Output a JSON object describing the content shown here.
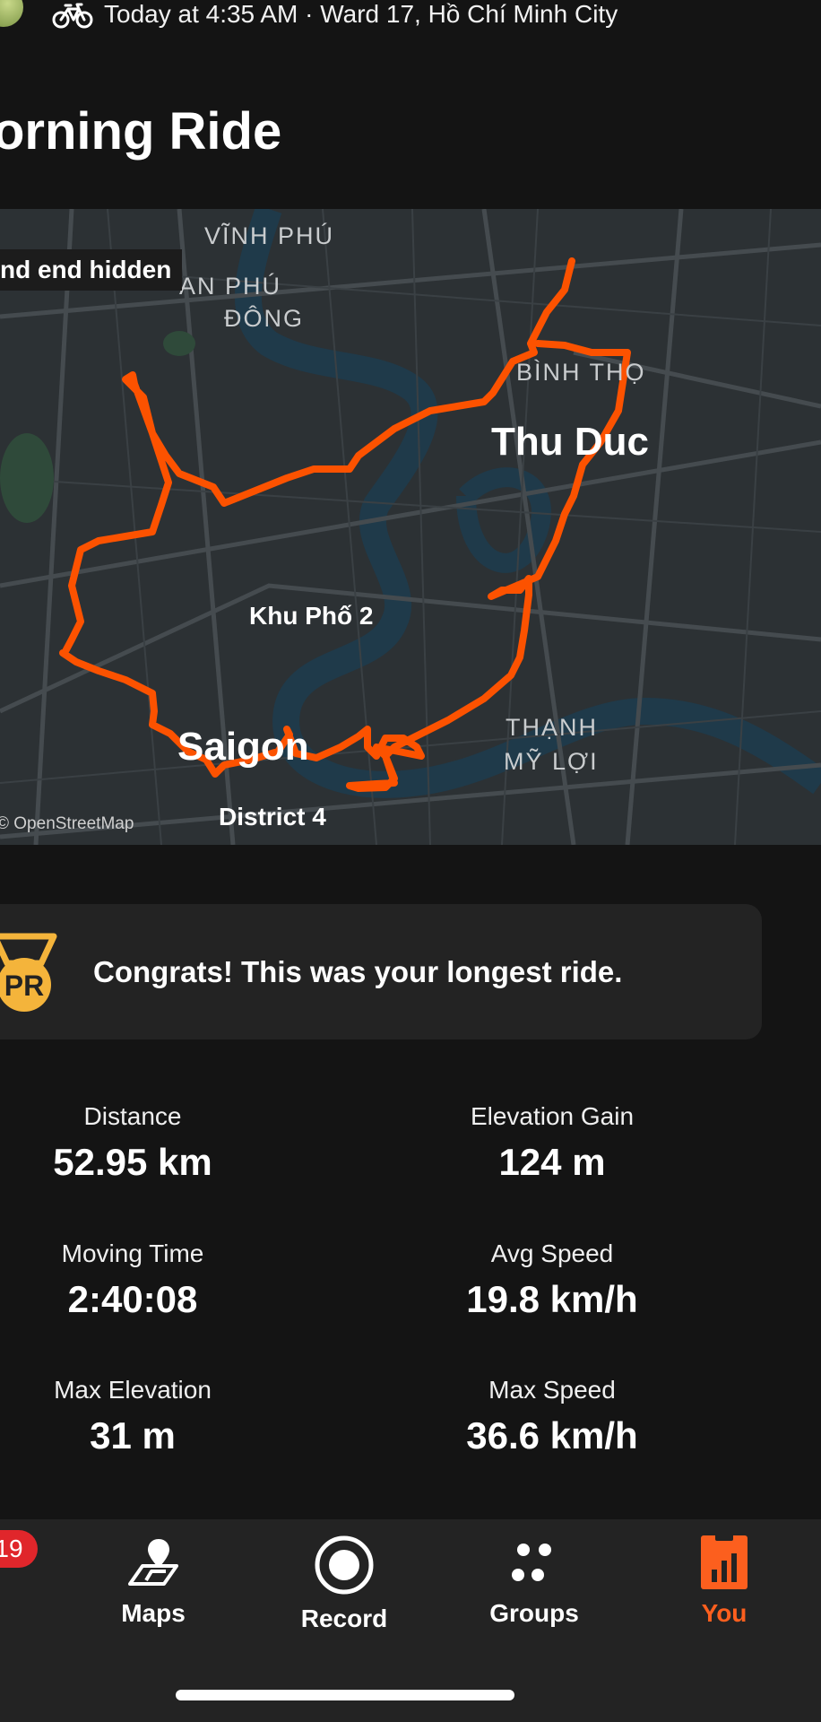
{
  "activity": {
    "meta": "Today at 4:35 AM · Ward 17, Hồ Chí Minh City",
    "title": "orning Ride"
  },
  "map": {
    "privacy_badge": "nd end hidden",
    "credit": "© OpenStreetMap",
    "labels": {
      "vinh_phu": "VĨNH PHÚ",
      "an_phu_dong": "AN PHÚ",
      "an_phu_dong_2": "ĐÔNG",
      "binh_tho": "BÌNH THỌ",
      "thu_duc": "Thu Duc",
      "khu_pho": "Khu Phố 2",
      "saigon": "Saigon",
      "district4": "District 4",
      "thanh_my_loi": "THẠNH",
      "thanh_my_loi_2": "MỸ LỢI"
    },
    "route_color": "#fc5200"
  },
  "achievement": {
    "badge_text": "PR",
    "message": "Congrats! This was your longest ride."
  },
  "stats": {
    "distance": {
      "label": "Distance",
      "value": "52.95 km"
    },
    "elevation_gain": {
      "label": "Elevation Gain",
      "value": "124 m"
    },
    "moving_time": {
      "label": "Moving Time",
      "value": "2:40:08"
    },
    "avg_speed": {
      "label": "Avg Speed",
      "value": "19.8 km/h"
    },
    "max_elevation": {
      "label": "Max Elevation",
      "value": "31 m"
    },
    "max_speed": {
      "label": "Max Speed",
      "value": "36.6 km/h"
    }
  },
  "nav": {
    "badge": "19",
    "items": [
      {
        "label": "Maps",
        "icon": "maps-icon"
      },
      {
        "label": "Record",
        "icon": "record-icon"
      },
      {
        "label": "Groups",
        "icon": "groups-icon"
      },
      {
        "label": "You",
        "icon": "you-icon",
        "active": true
      }
    ],
    "active_color": "#fc5f1e"
  }
}
